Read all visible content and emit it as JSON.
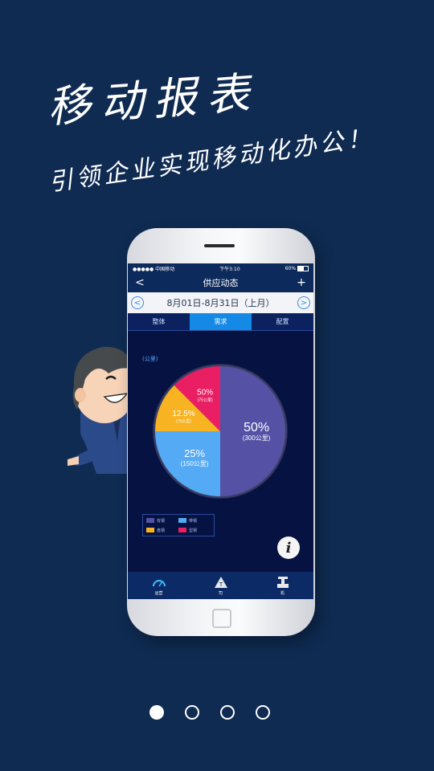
{
  "headline": "移动报表",
  "tagline": "引领企业实现移动化办公！",
  "phone": {
    "status_bar": {
      "carrier": "●●●●● 中国移动",
      "time": "下午3:10",
      "battery": "60%"
    },
    "nav": {
      "back": "<",
      "title": "供应动态",
      "add": "+"
    },
    "date_range": {
      "prev": "<",
      "text": "8月01日-8月31日（上月）",
      "next": ">"
    },
    "tabs": [
      "整体",
      "需求",
      "配置"
    ],
    "active_tab": 1,
    "unit_label": "(公里)",
    "chart_data": {
      "type": "pie",
      "slices": [
        {
          "label": "50%",
          "sub": "(300公里)",
          "value": 50,
          "color": "#5552a6"
        },
        {
          "label": "25%",
          "sub": "(150公里)",
          "value": 25,
          "color": "#55aaf5"
        },
        {
          "label": "12.5%",
          "sub": "(75公里)",
          "value": 12.5,
          "color": "#f7b321"
        },
        {
          "label": "50%",
          "sub": "(75公里)",
          "value": 12.5,
          "color": "#ea1e63"
        }
      ],
      "legend": [
        {
          "label": "有钢",
          "color": "#5552a6"
        },
        {
          "label": "带钢",
          "color": "#55aaf5"
        },
        {
          "label": "盘钢",
          "color": "#f7b321"
        },
        {
          "label": "型钢",
          "color": "#ea1e63"
        }
      ]
    },
    "info_button": "i",
    "bottom_nav": [
      {
        "label": "运营",
        "icon": "speedometer-icon"
      },
      {
        "label": "司",
        "icon": "truck-cone-icon"
      },
      {
        "label": "机",
        "icon": "machine-icon"
      }
    ]
  },
  "pager": {
    "count": 4,
    "active": 0
  }
}
